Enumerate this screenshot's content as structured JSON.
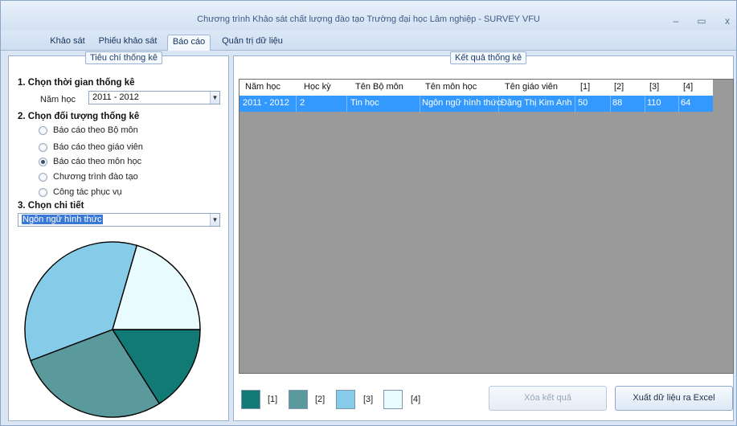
{
  "window": {
    "title": "Chương trình Khảo sát chất lượng đào tạo Trường đại học Lâm nghiệp - SURVEY VFU",
    "controls": {
      "minimize": "–",
      "maximize": "▭",
      "close": "x"
    }
  },
  "tabs": [
    {
      "label": "Khảo sát"
    },
    {
      "label": "Phiếu khảo sát"
    },
    {
      "label": "Báo cáo",
      "active": true
    },
    {
      "label": "Quản trị dữ liệu"
    }
  ],
  "left_panel": {
    "legend": "Tiêu chí thống kê",
    "section1": {
      "heading": "1. Chọn thời gian thống kê",
      "year_label": "Năm học",
      "year_value": "2011 - 2012"
    },
    "section2": {
      "heading": "2. Chọn đối tượng thống kê",
      "options": [
        {
          "label": "Báo cáo theo Bộ môn",
          "checked": false
        },
        {
          "label": "Báo cáo theo giáo viên",
          "checked": false
        },
        {
          "label": "Báo cáo theo môn học",
          "checked": true
        },
        {
          "label": "Chương trình đào tạo",
          "checked": false
        },
        {
          "label": "Công tác phục vụ",
          "checked": false
        }
      ]
    },
    "section3": {
      "heading": "3. Chọn chi tiết",
      "detail_value": "Ngôn ngữ hình thức"
    }
  },
  "right_panel": {
    "legend": "Kết quả thống kê",
    "table": {
      "columns": [
        "Năm học",
        "Học kỳ",
        "Tên Bộ môn",
        "Tên môn học",
        "Tên giáo viên",
        "[1]",
        "[2]",
        "[3]",
        "[4]"
      ],
      "rows": [
        [
          "2011 - 2012",
          "2",
          "Tin học",
          "Ngôn ngữ hình thức",
          "Đặng Thị Kim Anh",
          "50",
          "88",
          "110",
          "64"
        ]
      ]
    },
    "legend_items": [
      {
        "label": "[1]",
        "color": "#117a75"
      },
      {
        "label": "[2]",
        "color": "#5a9a9c"
      },
      {
        "label": "[3]",
        "color": "#86cce8"
      },
      {
        "label": "[4]",
        "color": "#e8fbff"
      }
    ],
    "buttons": {
      "clear": "Xóa kết quả",
      "export": "Xuất dữ liệu ra Excel"
    }
  },
  "pie": {
    "slices": [
      {
        "label": "[1]",
        "value": 50,
        "color": "#117a75"
      },
      {
        "label": "[2]",
        "value": 88,
        "color": "#5a9a9c"
      },
      {
        "label": "[3]",
        "value": 110,
        "color": "#86cce8"
      },
      {
        "label": "[4]",
        "value": 64,
        "color": "#e8fbff"
      }
    ]
  }
}
